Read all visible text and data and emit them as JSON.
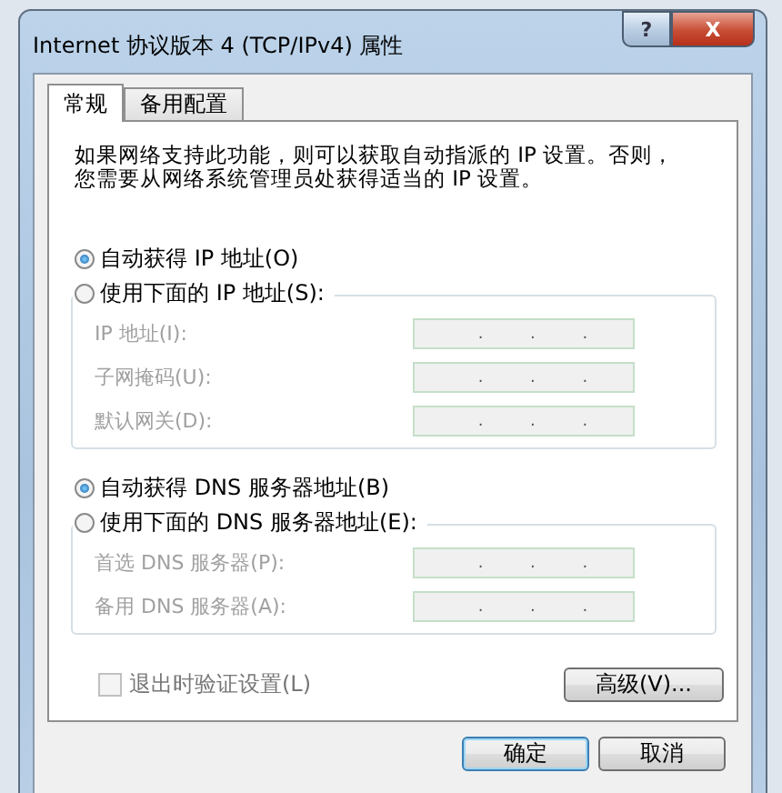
{
  "window": {
    "title": "Internet 协议版本 4 (TCP/IPv4) 属性",
    "help_button": "?",
    "close_button": "X"
  },
  "tabs": [
    {
      "label": "常规",
      "selected": true
    },
    {
      "label": "备用配置",
      "selected": false
    }
  ],
  "description": "如果网络支持此功能，则可以获取自动指派的 IP 设置。否则，您需要从网络系统管理员处获得适当的 IP 设置。",
  "ip_section": {
    "radios": [
      {
        "label": "自动获得 IP 地址(O)",
        "selected": true
      },
      {
        "label": "使用下面的 IP 地址(S):",
        "selected": false
      }
    ],
    "fields": [
      {
        "label": "IP 地址(I):",
        "disabled": true,
        "separators": [
          ".",
          ".",
          "."
        ]
      },
      {
        "label": "子网掩码(U):",
        "disabled": true,
        "separators": [
          ".",
          ".",
          "."
        ]
      },
      {
        "label": "默认网关(D):",
        "disabled": true,
        "separators": [
          ".",
          ".",
          "."
        ]
      }
    ]
  },
  "dns_section": {
    "radios": [
      {
        "label": "自动获得 DNS 服务器地址(B)",
        "selected": true
      },
      {
        "label": "使用下面的 DNS 服务器地址(E):",
        "selected": false
      }
    ],
    "fields": [
      {
        "label": "首选 DNS 服务器(P):",
        "disabled": true,
        "separators": [
          ".",
          ".",
          "."
        ]
      },
      {
        "label": "备用 DNS 服务器(A):",
        "disabled": true,
        "separators": [
          ".",
          ".",
          "."
        ]
      }
    ]
  },
  "validate_checkbox": {
    "label": "退出时验证设置(L)",
    "checked": false,
    "disabled": true
  },
  "advanced_button": "高级(V)...",
  "buttons": [
    {
      "label": "确定",
      "default": true
    },
    {
      "label": "取消",
      "default": false
    }
  ]
}
